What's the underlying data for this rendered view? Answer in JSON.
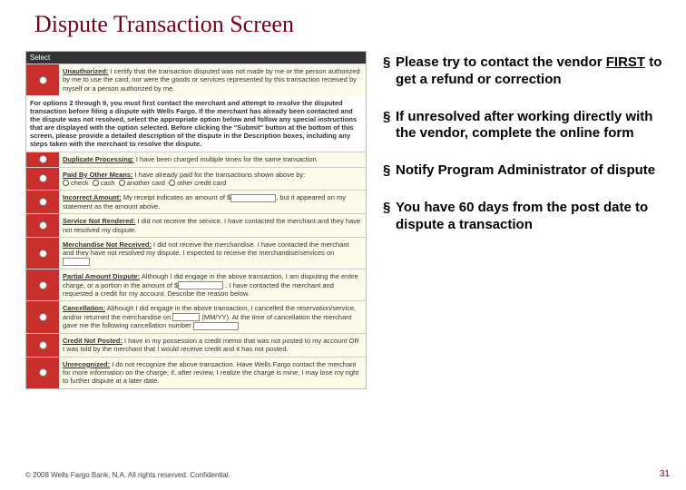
{
  "title": "Dispute Transaction Screen",
  "bullets": [
    {
      "pre": "Please try to contact the vendor ",
      "em": "FIRST",
      "post": " to get a refund or correction"
    },
    {
      "pre": "If unresolved after working directly with the vendor, complete the online form",
      "em": "",
      "post": ""
    },
    {
      "pre": "Notify Program Administrator of dispute",
      "em": "",
      "post": ""
    },
    {
      "pre": "You have 60 days from the post date to dispute a transaction",
      "em": "",
      "post": ""
    }
  ],
  "footer": "© 2008 Wells Fargo Bank, N.A. All rights reserved.   Confidential.",
  "pagenum": "31",
  "shot": {
    "header": "Select",
    "option1": {
      "name": "Unauthorized:",
      "text": "I certify that the transaction disputed was not made by me or the person authorized by me to use the card, nor were the goods or services represented by this transaction received by myself or a person authorized by me."
    },
    "instructions": "For options 2 through 9, you must first contact the merchant and attempt to resolve the disputed transaction before filing a dispute with Wells Fargo. If the merchant has already been contacted and the dispute was not resolved, select the appropriate option below and follow any special instructions that are displayed with the option selected. Before clicking the \"Submit\" button at the bottom of this screen, please provide a detailed description of the dispute in the Description boxes, including any steps taken with the merchant to resolve the dispute.",
    "option2": {
      "name": "Duplicate Processing:",
      "text": "I have been charged multiple times for the same transaction."
    },
    "option3": {
      "name": "Paid By Other Means:",
      "text": "I have already paid for the transactions shown above by:",
      "choices": [
        "check",
        "cash",
        "another card",
        "other credit card"
      ]
    },
    "option4": {
      "name": "Incorrect Amount:",
      "text1": "My receipt indicates an amount of $",
      "text2": ", but it appeared on my statement as the amount above."
    },
    "option5": {
      "name": "Service Not Rendered:",
      "text": "I did not receive the service. I have contacted the merchant and they have not resolved my dispute."
    },
    "option6": {
      "name": "Merchandise Not Received:",
      "text": "I did not receive the merchandise. I have contacted the merchant and they have not resolved my dispute. I expected to receive the merchandise/services on"
    },
    "option7": {
      "name": "Partial Amount Dispute:",
      "text": "Although I did engage in the above transaction, I am disputing the entire charge, or a portion in the amount of $",
      "text2": ". I have contacted the merchant and requested a credit for my account. Describe the reason below."
    },
    "option8": {
      "name": "Cancellation:",
      "text": "Although I did engage in the above transaction, I cancelled the reservation/service, and/or returned the merchandise on",
      "text2": "(MM/YY). At the time of cancellation the merchant gave me the following cancellation number"
    },
    "option9": {
      "name": "Credit Not Posted:",
      "text": "I have in my possession a credit memo that was not posted to my account OR I was told by the merchant that I would receive credit and it has not posted."
    },
    "option10": {
      "name": "Unrecognized:",
      "text": "I do not recognize the above transaction. Have Wells Fargo contact the merchant for more information on the charge; if, after review, I realize the charge is mine, I may lose my right to further dispute at a later date."
    }
  }
}
